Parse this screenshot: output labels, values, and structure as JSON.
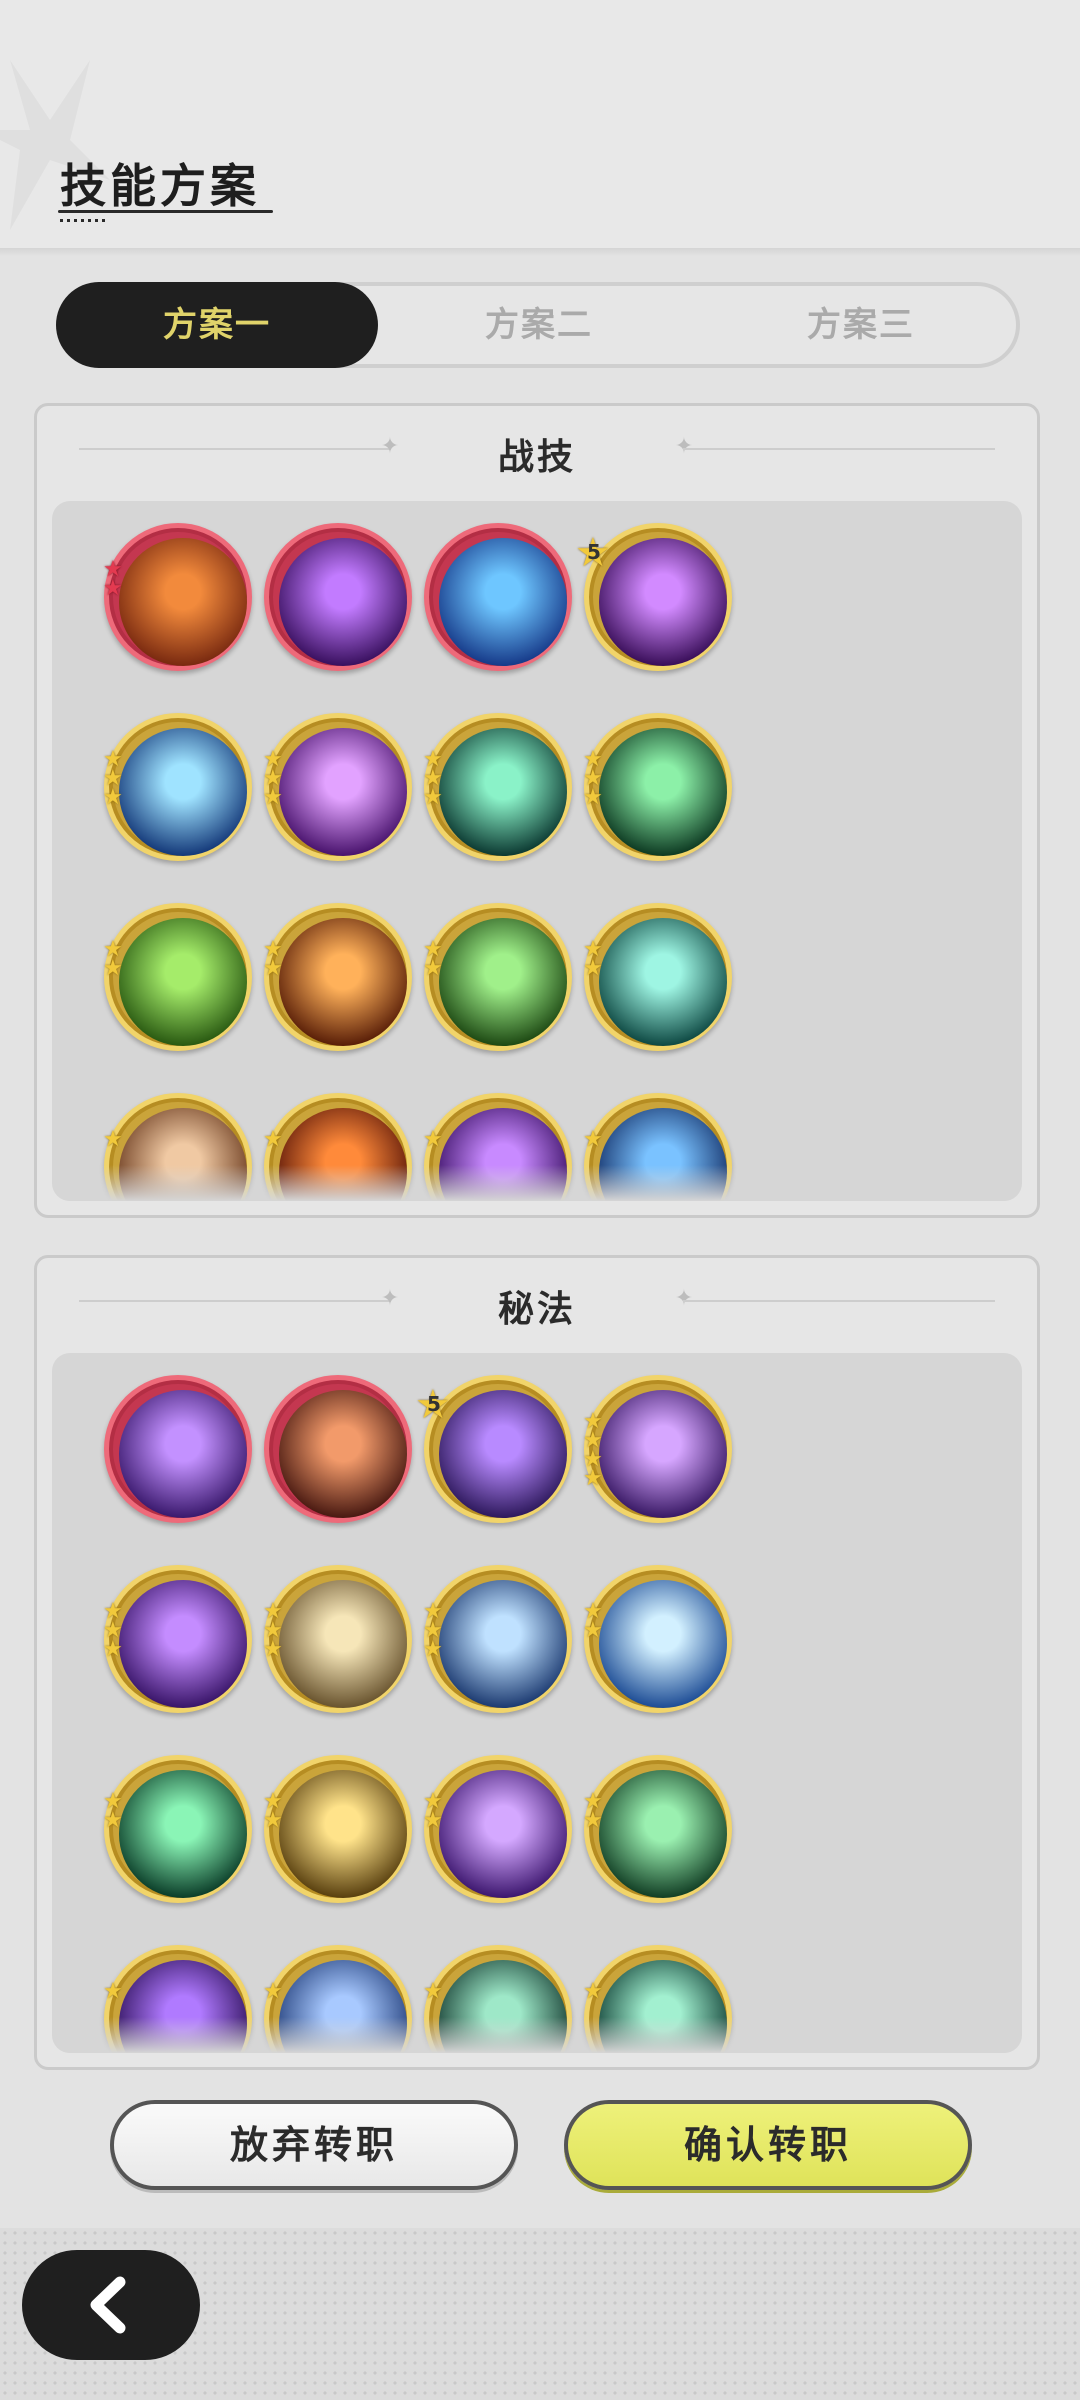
{
  "header": {
    "title": "技能方案"
  },
  "tabs": [
    {
      "label": "方案一",
      "active": true
    },
    {
      "label": "方案二",
      "active": false
    },
    {
      "label": "方案三",
      "active": false
    }
  ],
  "sections": {
    "combat": {
      "title": "战技",
      "icons": [
        {
          "name": "earth-golem-shield-icon",
          "ring": "red",
          "stars": 2,
          "star_color": "red",
          "colors": [
            "#f28a3c",
            "#7a2a10"
          ]
        },
        {
          "name": "void-star-burst-icon",
          "ring": "red",
          "stars": 0,
          "colors": [
            "#c27bff",
            "#3a1160"
          ]
        },
        {
          "name": "water-golem-icon",
          "ring": "red",
          "stars": 0,
          "colors": [
            "#6ec6ff",
            "#173b8a"
          ]
        },
        {
          "name": "shadow-hand-icon",
          "ring": "gold",
          "badge": "5",
          "colors": [
            "#d28aff",
            "#3a0f5a"
          ]
        },
        {
          "name": "ice-shatter-icon",
          "ring": "gold",
          "stars": 3,
          "colors": [
            "#9fe3ff",
            "#153a7a"
          ]
        },
        {
          "name": "arcane-explosion-icon",
          "ring": "gold",
          "stars": 3,
          "colors": [
            "#e2a2ff",
            "#4a146e"
          ]
        },
        {
          "name": "wind-slash-icon",
          "ring": "gold",
          "stars": 3,
          "colors": [
            "#8af2c8",
            "#0d3b33"
          ]
        },
        {
          "name": "healing-cross-icon",
          "ring": "gold",
          "stars": 3,
          "colors": [
            "#8cf0a8",
            "#0e3b23"
          ]
        },
        {
          "name": "tree-stump-icon",
          "ring": "gold",
          "stars": 2,
          "colors": [
            "#a5ec6a",
            "#2a5a12"
          ]
        },
        {
          "name": "fire-vortex-icon",
          "ring": "gold",
          "stars": 2,
          "colors": [
            "#ffb15a",
            "#5a1f08"
          ]
        },
        {
          "name": "green-flame-icon",
          "ring": "gold",
          "stars": 2,
          "colors": [
            "#a0f08a",
            "#1e4a14"
          ]
        },
        {
          "name": "cyclone-icon",
          "ring": "gold",
          "stars": 2,
          "colors": [
            "#9ef5e3",
            "#0f4a44"
          ]
        },
        {
          "name": "rock-spike-icon",
          "ring": "gold",
          "stars": 1,
          "colors": [
            "#f0c9a3",
            "#6a3a1e"
          ]
        },
        {
          "name": "flame-wall-icon",
          "ring": "gold",
          "stars": 1,
          "colors": [
            "#ff8a3a",
            "#5a1608"
          ]
        },
        {
          "name": "violet-constellation-icon",
          "ring": "gold",
          "stars": 1,
          "colors": [
            "#c88aff",
            "#3a1064"
          ]
        },
        {
          "name": "water-wave-icon",
          "ring": "gold",
          "stars": 1,
          "colors": [
            "#7ac2ff",
            "#122e66"
          ]
        }
      ]
    },
    "arcane": {
      "title": "秘法",
      "icons": [
        {
          "name": "third-eye-icon",
          "ring": "red",
          "stars": 0,
          "colors": [
            "#c391ff",
            "#3b1a6e"
          ]
        },
        {
          "name": "rock-crystal-icon",
          "ring": "red",
          "stars": 0,
          "colors": [
            "#f29a6a",
            "#4a1a12"
          ]
        },
        {
          "name": "ascend-figure-icon",
          "ring": "gold",
          "badge": "5",
          "colors": [
            "#b88aff",
            "#2f1a5e"
          ]
        },
        {
          "name": "heart-aura-icon",
          "ring": "gold",
          "stars": 4,
          "colors": [
            "#d6a6ff",
            "#3a1a66"
          ]
        },
        {
          "name": "violet-fist-icon",
          "ring": "gold",
          "stars": 3,
          "colors": [
            "#c48cff",
            "#3a166a"
          ]
        },
        {
          "name": "holy-ascension-icon",
          "ring": "gold",
          "stars": 3,
          "colors": [
            "#f6e6b8",
            "#6a5530"
          ]
        },
        {
          "name": "star-spark-icon",
          "ring": "gold",
          "stars": 3,
          "colors": [
            "#bfe1ff",
            "#1e3c72"
          ]
        },
        {
          "name": "ice-crystal-icon",
          "ring": "gold",
          "stars": 2,
          "colors": [
            "#d2f0ff",
            "#1f4e96"
          ]
        },
        {
          "name": "heart-heal-icon",
          "ring": "gold",
          "stars": 2,
          "colors": [
            "#8af5b6",
            "#0c3f2a"
          ]
        },
        {
          "name": "golden-strike-icon",
          "ring": "gold",
          "stars": 2,
          "colors": [
            "#ffe38a",
            "#5a4110"
          ]
        },
        {
          "name": "arcane-sigil-icon",
          "ring": "gold",
          "stars": 2,
          "colors": [
            "#d4a8ff",
            "#3e1870"
          ]
        },
        {
          "name": "nature-blessing-icon",
          "ring": "gold",
          "stars": 2,
          "colors": [
            "#9af0b0",
            "#134026"
          ]
        },
        {
          "name": "shadow-bind-icon",
          "ring": "gold",
          "stars": 1,
          "colors": [
            "#b07aff",
            "#2e115a"
          ]
        },
        {
          "name": "spirit-armor-icon",
          "ring": "gold",
          "stars": 1,
          "colors": [
            "#a8c9ff",
            "#223e7a"
          ]
        },
        {
          "name": "thorn-guard-icon",
          "ring": "gold",
          "stars": 1,
          "colors": [
            "#9ee8c8",
            "#143a30"
          ]
        },
        {
          "name": "emerald-ward-icon",
          "ring": "gold",
          "stars": 1,
          "colors": [
            "#a2f0d0",
            "#0f3e34"
          ]
        }
      ]
    }
  },
  "buttons": {
    "cancel": "放弃转职",
    "confirm": "确认转职"
  },
  "footer": {
    "back_icon": "chevron-left-icon"
  }
}
